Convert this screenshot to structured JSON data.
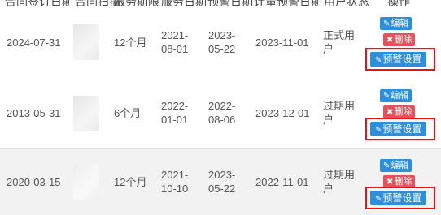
{
  "header": {
    "c1": "合同签订日期",
    "c2": "合同扫描",
    "c3": "服务期限",
    "c4": "服务日期",
    "c5": "预警日期",
    "c6": "计量预警日期",
    "c7": "用户状态",
    "c8": "操作"
  },
  "rows": [
    {
      "sign_date": "2024-07-31",
      "period": "12个月",
      "service_date_line1": "2021-",
      "service_date_line2": "08-01",
      "warn_date_line1": "2023-",
      "warn_date_line2": "05-22",
      "meter_warn_date": "2023-11-01",
      "status_line1": "正式用",
      "status_line2": "户",
      "edit_label": "编辑",
      "delete_label": "删除",
      "warn_label": "预警设置"
    },
    {
      "sign_date": "2013-05-31",
      "period": "6个月",
      "service_date_line1": "2022-",
      "service_date_line2": "01-01",
      "warn_date_line1": "2022-",
      "warn_date_line2": "08-06",
      "meter_warn_date": "2023-12-01",
      "status_line1": "过期用",
      "status_line2": "户",
      "edit_label": "编辑",
      "delete_label": "删除",
      "warn_label": "预警设置"
    },
    {
      "sign_date": "2020-03-15",
      "period": "12个月",
      "service_date_line1": "2021-",
      "service_date_line2": "10-10",
      "warn_date_line1": "2023-",
      "warn_date_line2": "05-22",
      "meter_warn_date": "2022-11-01",
      "status_line1": "过期用",
      "status_line2": "户",
      "edit_label": "编辑",
      "delete_label": "删除",
      "warn_label": "预警设置"
    }
  ],
  "icons": {
    "edit": "edit-icon",
    "delete": "close-icon",
    "warn": "edit-icon"
  },
  "colors": {
    "primary_button": "#2c8fdd",
    "danger_button": "#e8505b",
    "highlight_frame": "#f01010",
    "alt_row": "#f2f2f2"
  }
}
